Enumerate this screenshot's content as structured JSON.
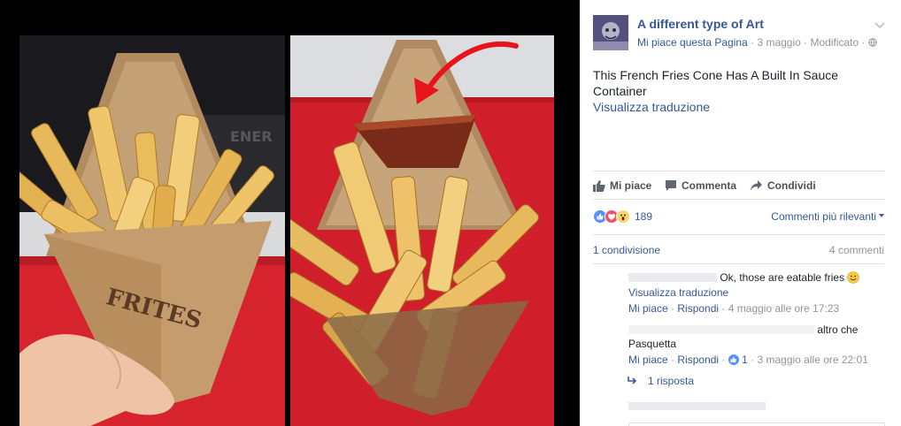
{
  "page": {
    "name": "A different type of Art",
    "like_page": "Mi piace questa Pagina",
    "date": "3 maggio",
    "edited": "Modificato",
    "audience_icon": "globe-icon"
  },
  "post": {
    "text": "This French Fries Cone Has A Built In Sauce Container",
    "see_translation": "Visualizza traduzione"
  },
  "photos": {
    "left": {
      "print": "FRITES",
      "sign": "ENER"
    },
    "right": {
      "annotation_icon": "red-arrow"
    }
  },
  "actions": {
    "like": "Mi piace",
    "comment": "Commenta",
    "share": "Condividi"
  },
  "reactions": {
    "icons": [
      "like-reaction-icon",
      "love-reaction-icon",
      "wow-reaction-icon"
    ],
    "count": "189",
    "sort_label": "Commenti più rilevanti"
  },
  "stats": {
    "shares": "1 condivisione",
    "comments": "4 commenti"
  },
  "comments": [
    {
      "text": "Ok, those are eatable fries",
      "see_translation": "Visualizza traduzione",
      "like": "Mi piace",
      "reply": "Rispondi",
      "time": "4 maggio alle ore 17:23"
    },
    {
      "text_tail": "altro che",
      "text_line2": "Pasquetta",
      "like": "Mi piace",
      "reply": "Rispondi",
      "likes": "1",
      "time": "3 maggio alle ore 22:01",
      "replies": "1 risposta"
    }
  ],
  "colors": {
    "link": "#365899",
    "meta": "#90949c",
    "divider": "#dddfe2",
    "like_blue": "#5890ff",
    "love_red": "#f25268",
    "wow_yellow": "#fcd669"
  }
}
